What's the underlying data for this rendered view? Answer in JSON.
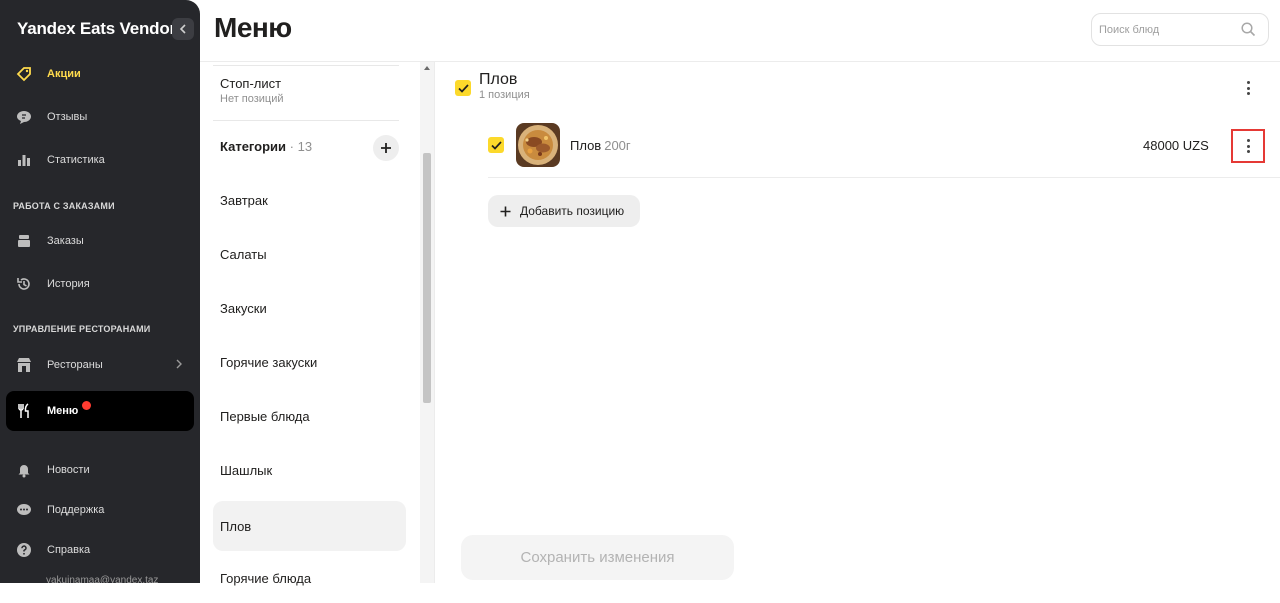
{
  "sidebar": {
    "brand": "Yandex Eats Vendor",
    "items_top": [
      {
        "label": "Акции",
        "icon": "tag-icon"
      },
      {
        "label": "Отзывы",
        "icon": "chat-bubble-icon"
      },
      {
        "label": "Статистика",
        "icon": "bar-chart-icon"
      }
    ],
    "section_orders": "РАБОТА С ЗАКАЗАМИ",
    "items_orders": [
      {
        "label": "Заказы",
        "icon": "orders-icon"
      },
      {
        "label": "История",
        "icon": "history-icon"
      }
    ],
    "section_restaurants": "УПРАВЛЕНИЕ РЕСТОРАНАМИ",
    "items_restaurants": [
      {
        "label": "Рестораны",
        "icon": "restaurant-icon"
      },
      {
        "label": "Меню",
        "icon": "fork-knife-icon"
      }
    ],
    "items_bottom": [
      {
        "label": "Новости",
        "icon": "bell-icon"
      },
      {
        "label": "Поддержка",
        "icon": "support-chat-icon"
      },
      {
        "label": "Справка",
        "icon": "help-icon"
      }
    ],
    "email": "yakuinamaa@yandex.taz"
  },
  "header": {
    "title": "Меню",
    "search_placeholder": "Поиск блюд"
  },
  "categories": {
    "stop_list_title": "Стоп-лист",
    "stop_list_sub": "Нет позиций",
    "header_label": "Категории",
    "count": "· 13",
    "items": [
      "Завтрак",
      "Салаты",
      "Закуски",
      "Горячие закуски",
      "Первые блюда",
      "Шашлык",
      "Плов",
      "Горячие блюда"
    ],
    "active": "Плов"
  },
  "group": {
    "title": "Плов",
    "subtitle": "1 позиция",
    "items": [
      {
        "name": "Плов",
        "weight": "200г",
        "price": "48000 UZS"
      }
    ],
    "add_label": "Добавить позицию"
  },
  "footer": {
    "save_label": "Сохранить изменения"
  },
  "colors": {
    "accent": "#fcd92b",
    "sidebar_bg": "#26272b",
    "promo": "#ffdb4d",
    "highlight_border": "#e53935"
  }
}
